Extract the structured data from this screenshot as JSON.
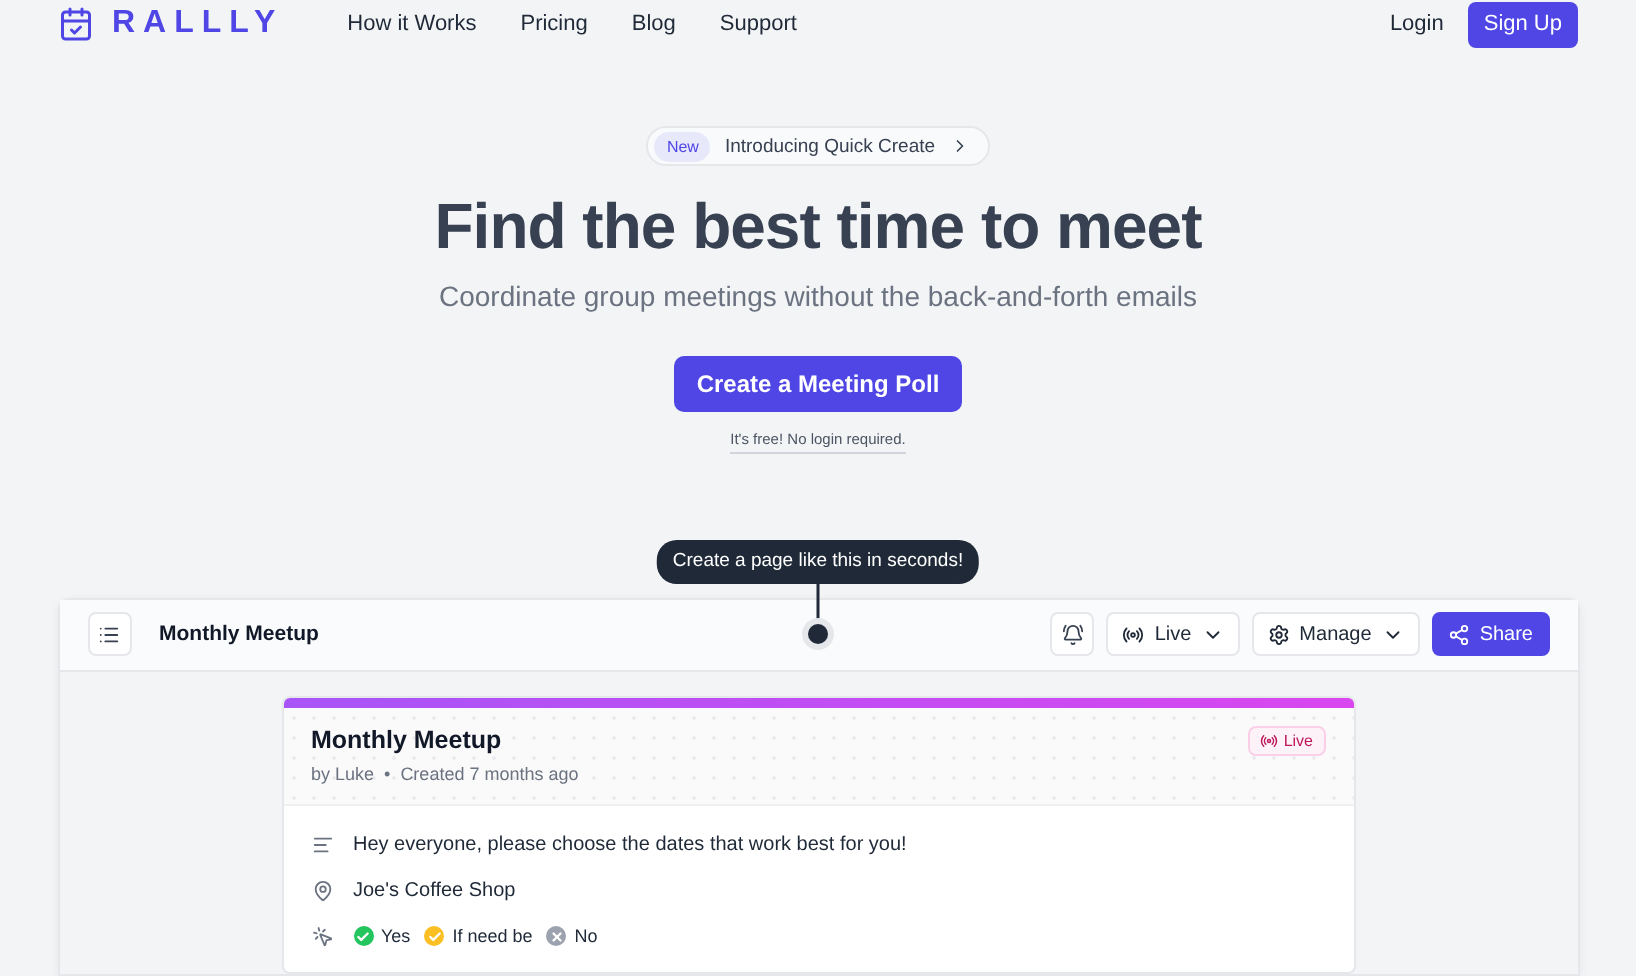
{
  "brand": {
    "name": "RALLLY"
  },
  "nav": {
    "links": [
      {
        "label": "How it Works"
      },
      {
        "label": "Pricing"
      },
      {
        "label": "Blog"
      },
      {
        "label": "Support"
      }
    ],
    "login": "Login",
    "signup": "Sign Up"
  },
  "hero": {
    "badge": "New",
    "announcement": "Introducing Quick Create",
    "title": "Find the best time to meet",
    "subtitle": "Coordinate group meetings without the back-and-forth emails",
    "cta": "Create a Meeting Poll",
    "note": "It's free! No login required."
  },
  "demo": {
    "tooltip": "Create a page like this in seconds!",
    "toolbar": {
      "title": "Monthly Meetup",
      "status": "Live",
      "manage": "Manage",
      "share": "Share"
    },
    "card": {
      "title": "Monthly Meetup",
      "author": "by Luke",
      "separator": "•",
      "created": "Created 7 months ago",
      "status": "Live",
      "description": "Hey everyone, please choose the dates that work best for you!",
      "location": "Joe's Coffee Shop",
      "legend": [
        {
          "kind": "yes",
          "label": "Yes",
          "color": "#22c55e"
        },
        {
          "kind": "ifneedbe",
          "label": "If need be",
          "color": "#fbbf24"
        },
        {
          "kind": "no",
          "label": "No",
          "color": "#9ca3af"
        }
      ]
    }
  }
}
